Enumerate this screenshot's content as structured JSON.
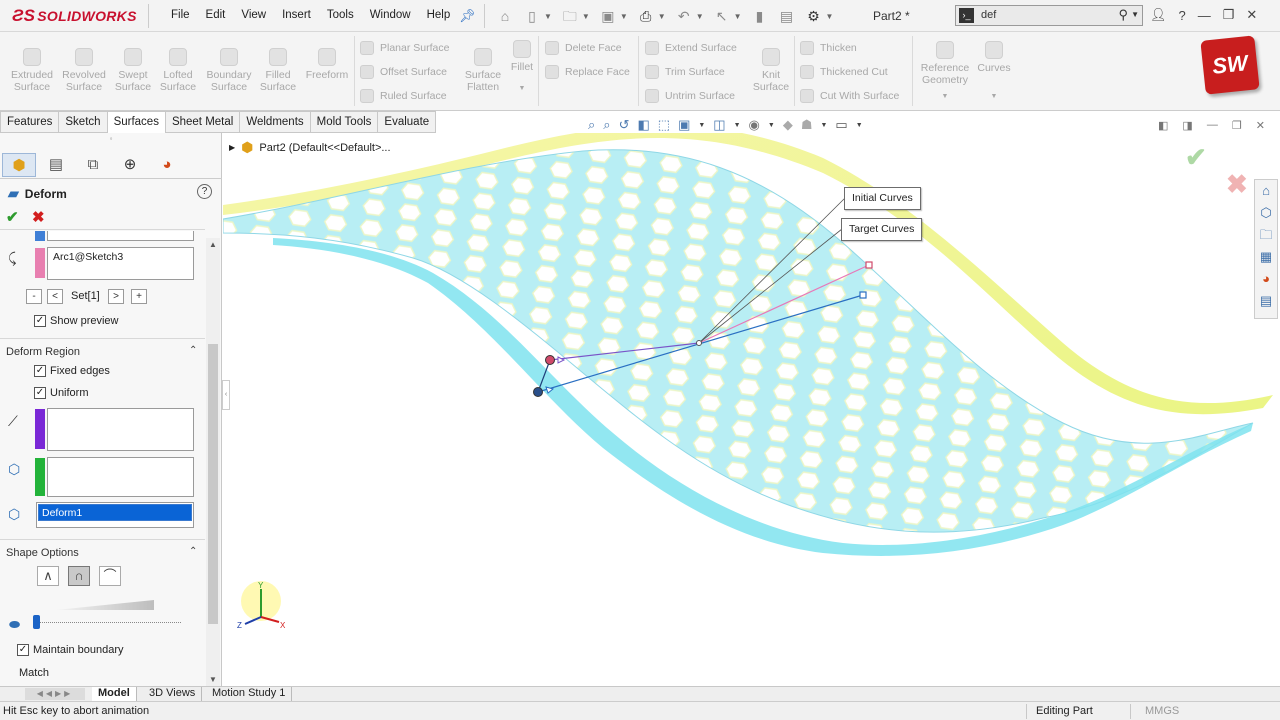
{
  "app": {
    "brand": "SOLIDWORKS",
    "doc_title": "Part2 *"
  },
  "menu": [
    "File",
    "Edit",
    "View",
    "Insert",
    "Tools",
    "Window",
    "Help"
  ],
  "search": {
    "value": "def"
  },
  "ribbon": {
    "big_tools": [
      "Extruded\nSurface",
      "Revolved\nSurface",
      "Swept\nSurface",
      "Lofted\nSurface",
      "Boundary\nSurface",
      "Filled\nSurface",
      "Freeform"
    ],
    "col1": [
      "Planar Surface",
      "Offset Surface",
      "Ruled Surface"
    ],
    "surface_flatten": "Surface\nFlatten",
    "fillet": "Fillet",
    "col2": [
      "Delete Face",
      "Replace Face"
    ],
    "col3": [
      "Extend Surface",
      "Trim Surface",
      "Untrim Surface"
    ],
    "knit": "Knit\nSurface",
    "col4": [
      "Thicken",
      "Thickened Cut",
      "Cut With Surface"
    ],
    "ref_geom": "Reference\nGeometry",
    "curves": "Curves"
  },
  "tabs": [
    "Features",
    "Sketch",
    "Surfaces",
    "Sheet Metal",
    "Weldments",
    "Mold Tools",
    "Evaluate"
  ],
  "active_tab": "Surfaces",
  "property_manager": {
    "title": "Deform",
    "curve_item": "Arc1@Sketch3",
    "set_label": "Set[1]",
    "show_preview": "Show preview",
    "region_title": "Deform Region",
    "fixed_edges": "Fixed edges",
    "uniform": "Uniform",
    "selected_body": "Deform1",
    "shape_title": "Shape Options",
    "maintain_boundary": "Maintain boundary",
    "match": "Match",
    "colors": {
      "curve_bar": "#e87fb0",
      "edge_bar": "#7a28d6",
      "face_bar": "#23b33a"
    }
  },
  "feature_tree": {
    "root": "Part2  (Default<<Default>..."
  },
  "callouts": {
    "initial": "Initial Curves",
    "target": "Target Curves"
  },
  "bottom_tabs": [
    "Model",
    "3D Views",
    "Motion Study 1"
  ],
  "status": {
    "message": "Hit Esc key to abort animation",
    "mode": "Editing Part",
    "units": "MMGS"
  },
  "triad": {
    "x": "X",
    "y": "Y",
    "z": "Z"
  }
}
